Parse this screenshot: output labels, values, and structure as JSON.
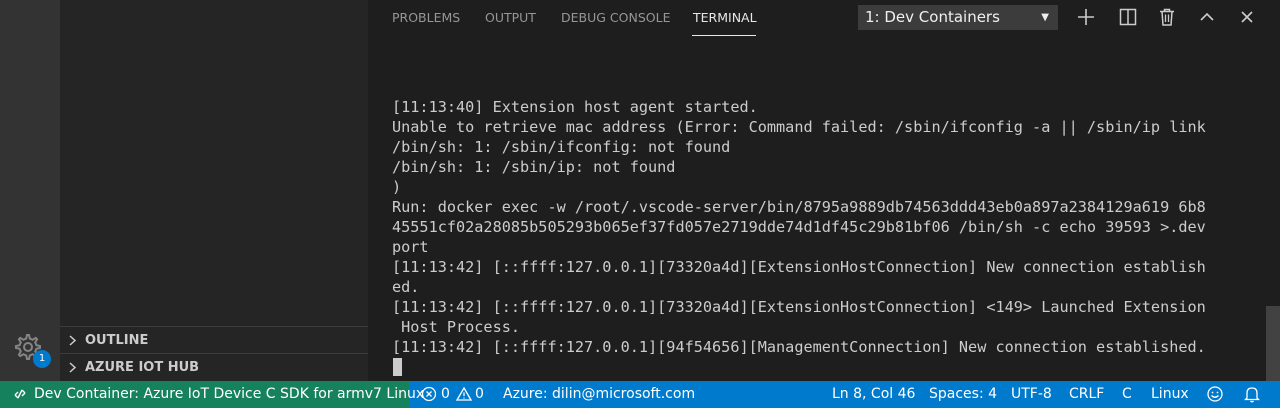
{
  "sidebar": {
    "sections": [
      {
        "label": "OUTLINE"
      },
      {
        "label": "AZURE IOT HUB"
      }
    ],
    "settings_badge": "1"
  },
  "panel": {
    "tabs": [
      {
        "label": "PROBLEMS"
      },
      {
        "label": "OUTPUT"
      },
      {
        "label": "DEBUG CONSOLE"
      },
      {
        "label": "TERMINAL"
      }
    ],
    "active_tab": "TERMINAL",
    "terminal_select": "1: Dev Containers",
    "terminal_lines": [
      "[11:13:40] Extension host agent started.",
      "Unable to retrieve mac address (Error: Command failed: /sbin/ifconfig -a || /sbin/ip link",
      "/bin/sh: 1: /sbin/ifconfig: not found",
      "/bin/sh: 1: /sbin/ip: not found",
      ")",
      "Run: docker exec -w /root/.vscode-server/bin/8795a9889db74563ddd43eb0a897a2384129a619 6b8",
      "45551cf02a28085b505293b065ef37fd057e2719dde74d1df45c29b81bf06 /bin/sh -c echo 39593 >.dev",
      "port",
      "[11:13:42] [::ffff:127.0.0.1][73320a4d][ExtensionHostConnection] New connection establish",
      "ed.",
      "[11:13:42] [::ffff:127.0.0.1][73320a4d][ExtensionHostConnection] <149> Launched Extension",
      " Host Process.",
      "[11:13:42] [::ffff:127.0.0.1][94f54656][ManagementConnection] New connection established."
    ]
  },
  "statusbar": {
    "remote": "Dev Container: Azure IoT Device C SDK for armv7 Linux",
    "errors": "0",
    "warnings": "0",
    "azure": "Azure: dilin@microsoft.com",
    "position": "Ln 8, Col 46",
    "spaces": "Spaces: 4",
    "encoding": "UTF-8",
    "eol": "CRLF",
    "language": "C",
    "os": "Linux"
  },
  "colors": {
    "statusbar": "#007acc",
    "remote": "#16825d",
    "activitybar": "#333333",
    "sidebar": "#252526",
    "panel": "#1e1e1e"
  },
  "icons": [
    "gear-icon",
    "plus-icon",
    "split-icon",
    "trash-icon",
    "chevron-up-icon",
    "close-icon",
    "remote-icon",
    "error-icon",
    "warning-icon",
    "smiley-icon",
    "bell-icon"
  ]
}
